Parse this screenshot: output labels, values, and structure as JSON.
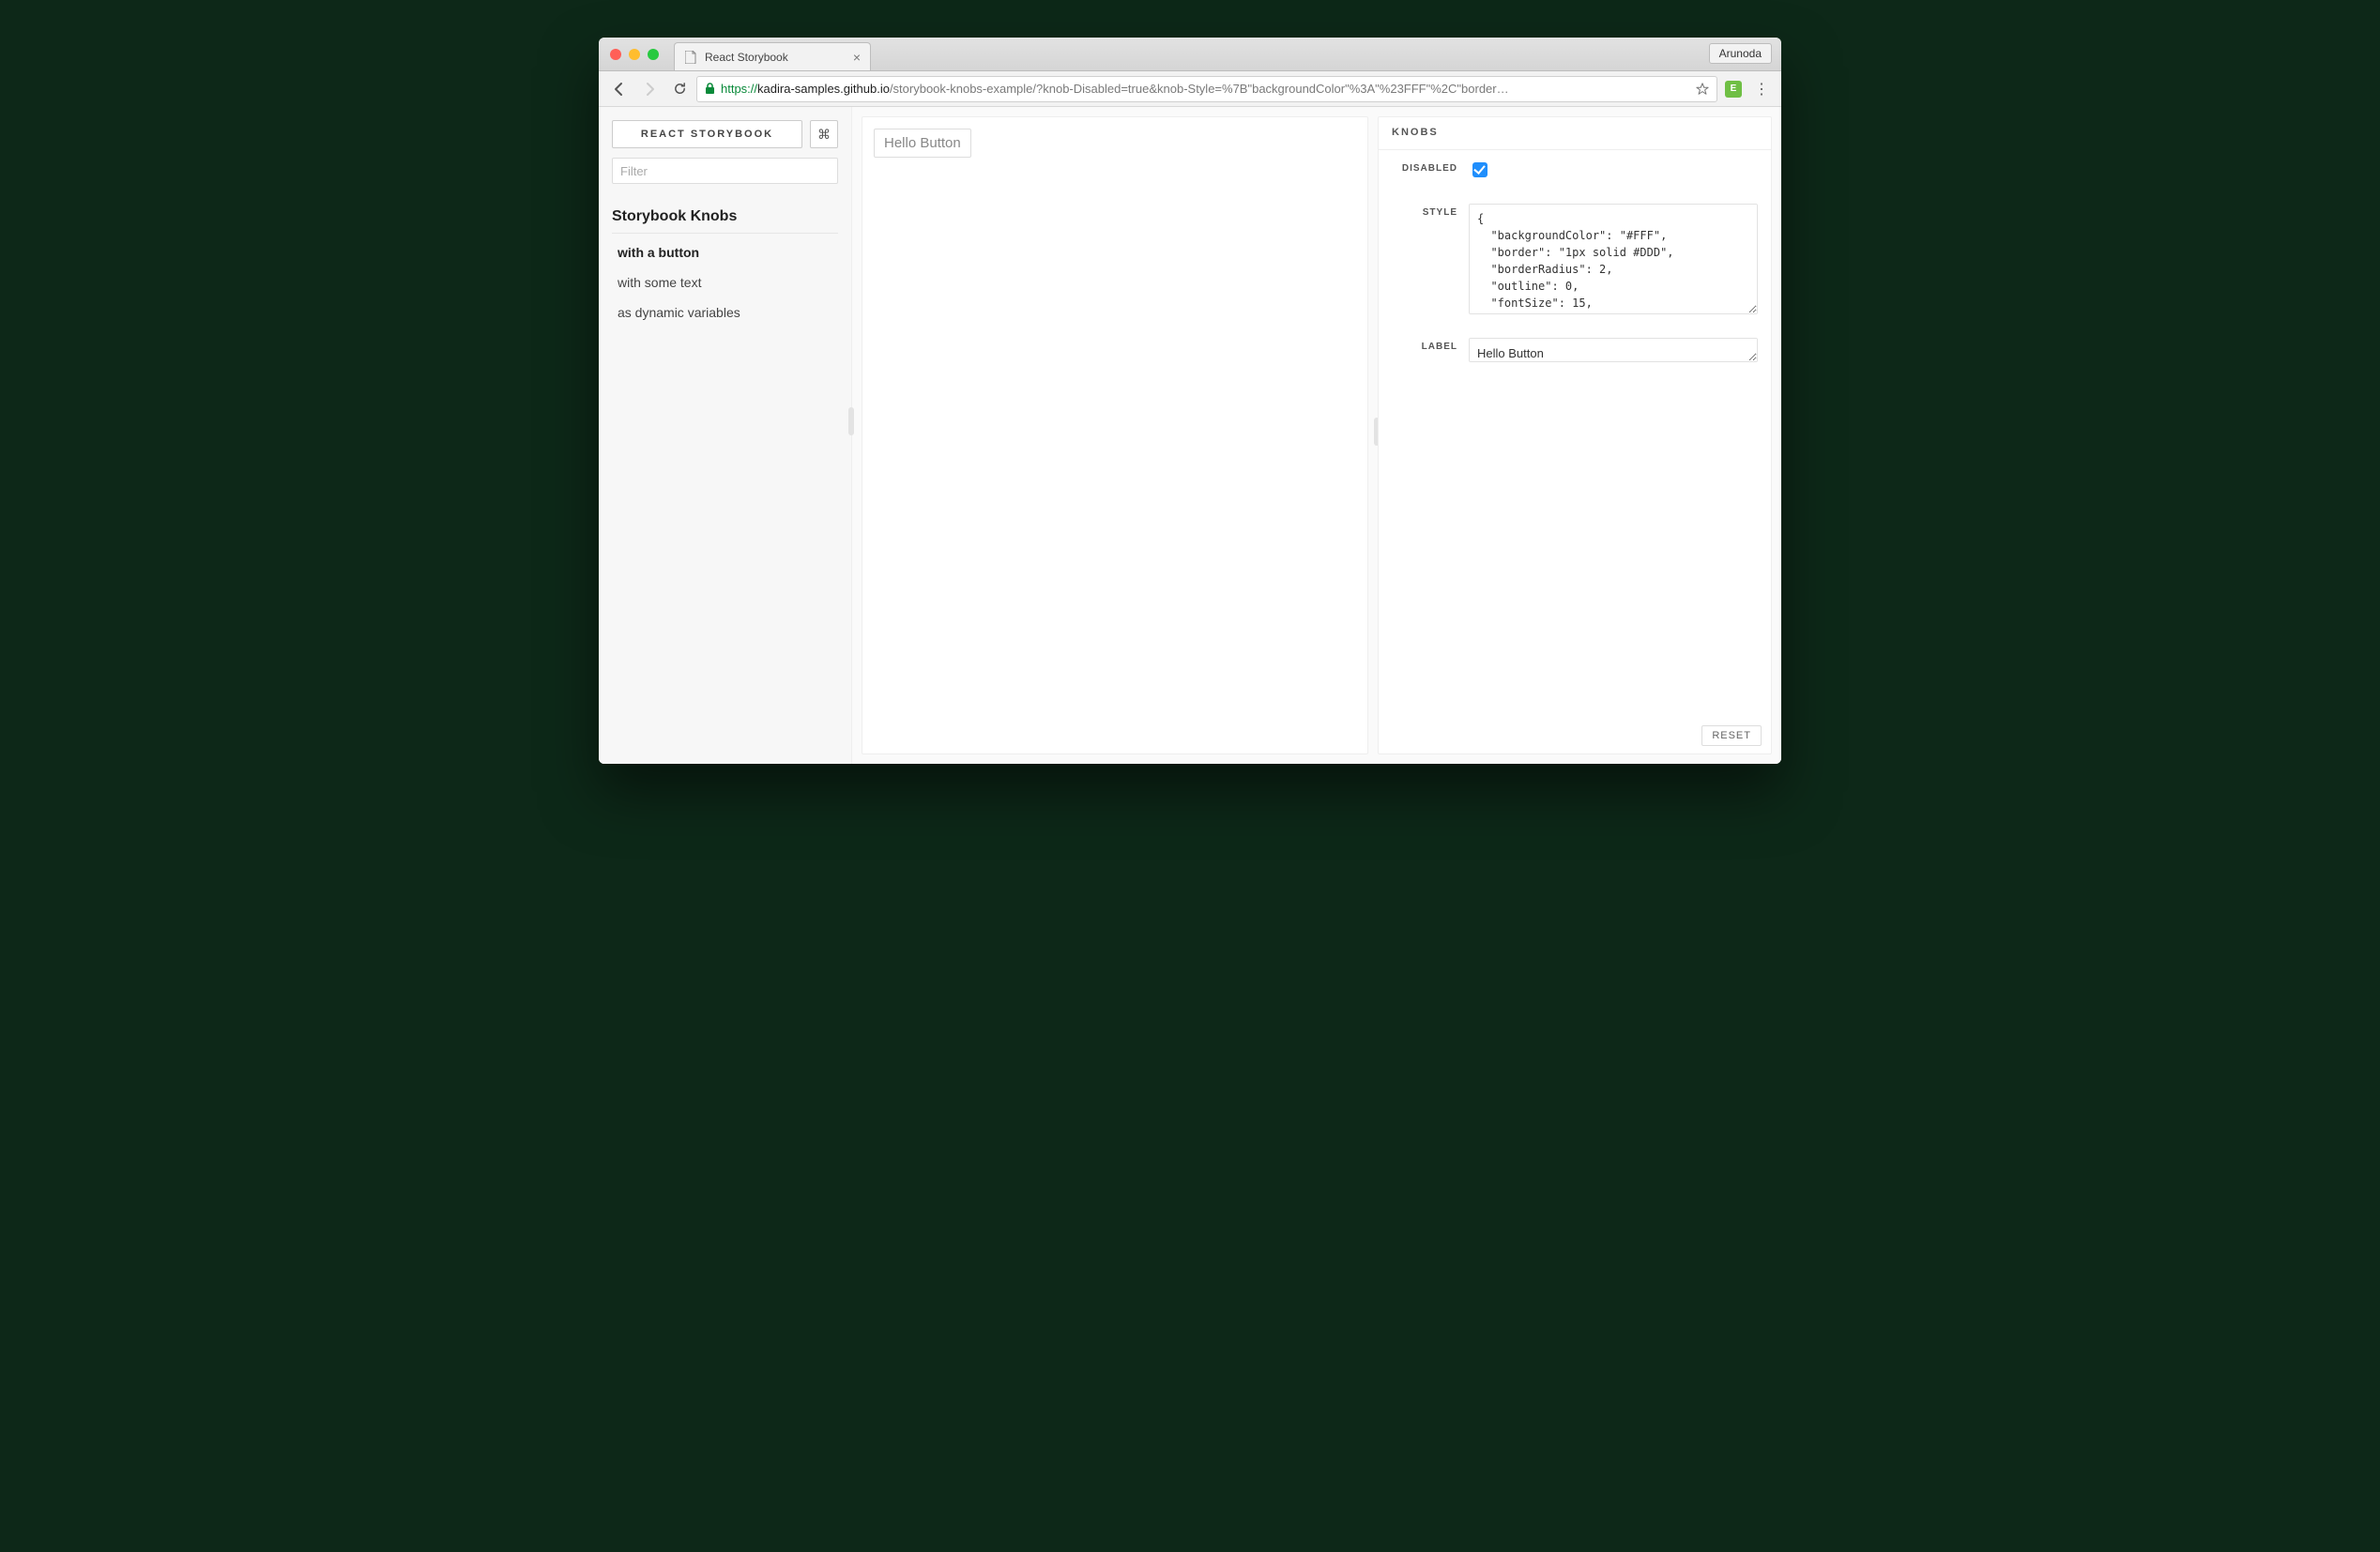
{
  "browser": {
    "tab_title": "React Storybook",
    "profile_name": "Arunoda",
    "url_proto": "https://",
    "url_host": "kadira-samples.github.io",
    "url_path": "/storybook-knobs-example/?knob-Disabled=true&knob-Style=%7B\"backgroundColor\"%3A\"%23FFF\"%2C\"border…",
    "star_icon": "star-icon"
  },
  "sidebar": {
    "title": "REACT STORYBOOK",
    "cmd_glyph": "⌘",
    "filter_placeholder": "Filter",
    "section": "Storybook Knobs",
    "items": [
      {
        "label": "with a button",
        "active": true
      },
      {
        "label": "with some text",
        "active": false
      },
      {
        "label": "as dynamic variables",
        "active": false
      }
    ]
  },
  "preview": {
    "button_label": "Hello Button"
  },
  "panel": {
    "title": "KNOBS",
    "knobs": {
      "disabled": {
        "label": "DISABLED",
        "checked": true
      },
      "style": {
        "label": "STYLE",
        "value": "{\n  \"backgroundColor\": \"#FFF\",\n  \"border\": \"1px solid #DDD\",\n  \"borderRadius\": 2,\n  \"outline\": 0,\n  \"fontSize\": 15,\n  \"cursor\": \"pointer\"\n}"
      },
      "label_knob": {
        "label": "LABEL",
        "value": "Hello Button"
      }
    },
    "reset": "RESET"
  }
}
